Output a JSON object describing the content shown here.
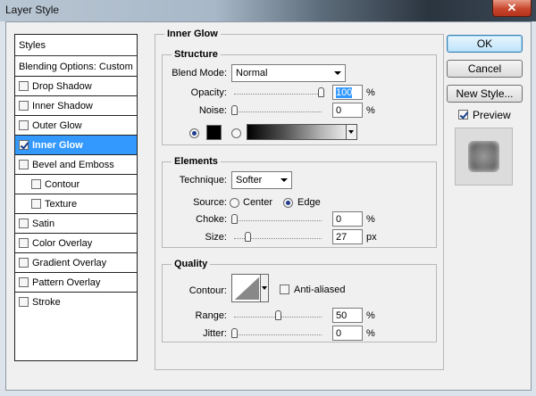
{
  "window": {
    "title": "Layer Style",
    "close_glyph": "✕"
  },
  "styles_list": {
    "header": "Styles",
    "blending": "Blending Options: Custom",
    "items": [
      {
        "label": "Drop Shadow",
        "checked": false
      },
      {
        "label": "Inner Shadow",
        "checked": false
      },
      {
        "label": "Outer Glow",
        "checked": false
      },
      {
        "label": "Inner Glow",
        "checked": true
      },
      {
        "label": "Bevel and Emboss",
        "checked": false
      },
      {
        "label": "Contour",
        "checked": false
      },
      {
        "label": "Texture",
        "checked": false
      },
      {
        "label": "Satin",
        "checked": false
      },
      {
        "label": "Color Overlay",
        "checked": false
      },
      {
        "label": "Gradient Overlay",
        "checked": false
      },
      {
        "label": "Pattern Overlay",
        "checked": false
      },
      {
        "label": "Stroke",
        "checked": false
      }
    ]
  },
  "inner_glow": {
    "title": "Inner Glow",
    "structure": {
      "title": "Structure",
      "blend_mode_label": "Blend Mode:",
      "blend_mode_value": "Normal",
      "opacity_label": "Opacity:",
      "opacity_value": "100",
      "opacity_unit": "%",
      "noise_label": "Noise:",
      "noise_value": "0",
      "noise_unit": "%",
      "color": "#000000"
    },
    "elements": {
      "title": "Elements",
      "technique_label": "Technique:",
      "technique_value": "Softer",
      "source_label": "Source:",
      "source_center": "Center",
      "source_edge": "Edge",
      "choke_label": "Choke:",
      "choke_value": "0",
      "choke_unit": "%",
      "size_label": "Size:",
      "size_value": "27",
      "size_unit": "px"
    },
    "quality": {
      "title": "Quality",
      "contour_label": "Contour:",
      "anti_aliased_label": "Anti-aliased",
      "range_label": "Range:",
      "range_value": "50",
      "range_unit": "%",
      "jitter_label": "Jitter:",
      "jitter_value": "0",
      "jitter_unit": "%"
    }
  },
  "buttons": {
    "ok": "OK",
    "cancel": "Cancel",
    "new_style": "New Style..."
  },
  "preview": {
    "label": "Preview",
    "checked": true
  },
  "colors": {
    "selection": "#3399ff",
    "accent": "#1e3c8c"
  }
}
